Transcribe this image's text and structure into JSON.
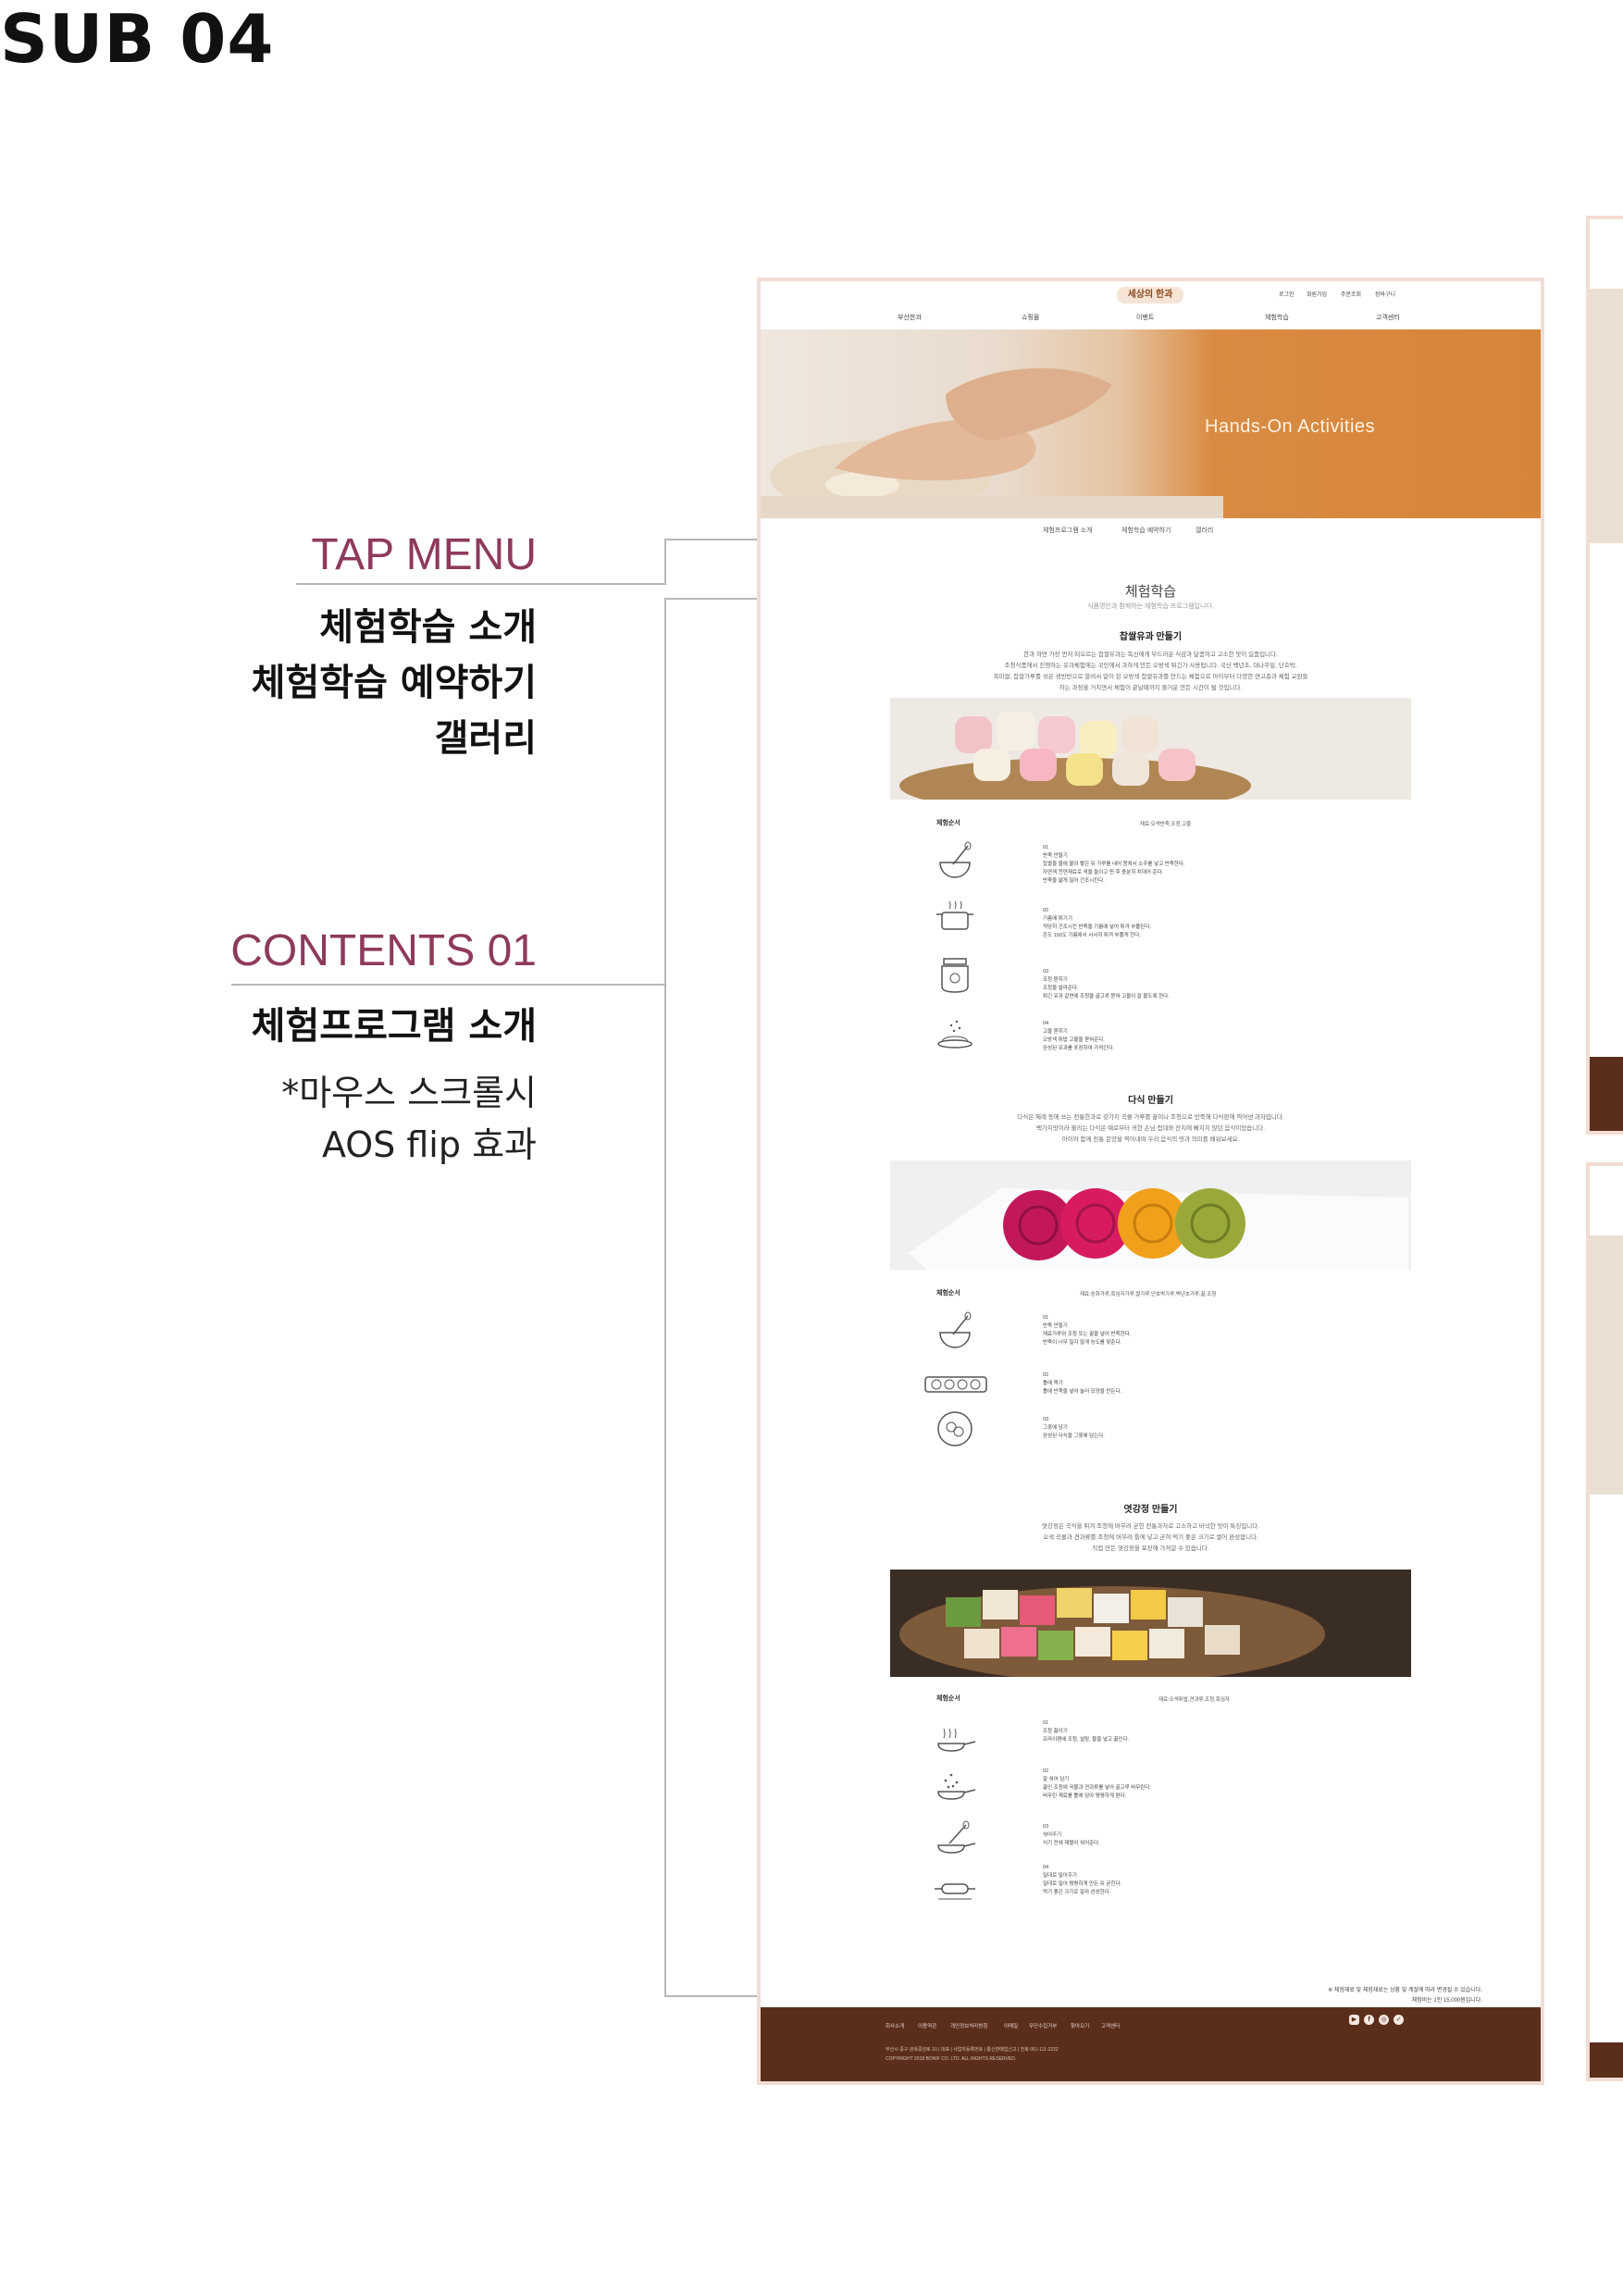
{
  "page": {
    "sub_title": "SUB 04",
    "tap_menu": {
      "heading": "TAP MENU",
      "items": [
        "체험학습 소개",
        "체험학습 예약하기",
        "갤러리"
      ]
    },
    "contents": {
      "heading": "CONTENTS 01",
      "title": "체험프로그램 소개",
      "notes": [
        "*마우스 스크롤시",
        "AOS flip 효과"
      ]
    }
  },
  "site": {
    "logo": "세상의 한과",
    "util_links": [
      "로그인",
      "회원가입",
      "주문조회",
      "장바구니"
    ],
    "gnb": [
      "부산한과",
      "쇼핑몰",
      "이벤트",
      "체험학습",
      "고객센터"
    ],
    "hero_title": "Hands-On Activities",
    "tabs": [
      "체험프로그램 소개",
      "체험학습 예약하기",
      "갤러리"
    ],
    "page_heading": "체험학습",
    "page_subheading": "식품명인과 함께하는 체험학습 프로그램입니다.",
    "sections": [
      {
        "title": "찹쌀유과 만들기",
        "paragraph": [
          "한과 하면 가장 먼저 떠오르는 찹쌀유과는 독신에게 부드러운 식감과 달콤하고 고소한 맛이 일품입니다.",
          "조청식품에서 진행하는 유과체험에는 국민에서 과하게 만든 오방색 튀긴가 사용됩니다. 국산 백년초, 대나무잎, 단호박,",
          "흑미쌀, 찹쌀가루를 섞은 생반반으로 말려서 알이 된 오방색 찹쌀유과를 만드는 체험으로 아이부터 다양한 연고층과 체험 교원들",
          "하는 과정을 거치면서 체험이 끝날때까지 즐거운 만든 시간이 될 것입니다."
        ],
        "order_label": "체험순서",
        "order_meta": "재료:오색반죽,조청,고물",
        "steps": [
          {
            "icon": "whisk-bowl-icon",
            "lines": [
              "01",
              "반죽 만들기",
              "찹쌀을 물에 불려 빻은 뒤 가루를 내어 뭉쳐서 소주를 넣고 반죽한다.",
              "자연색 천연재료로 색을 들이고 찐 후 충분히 치대어 준다.",
              "반죽을 얇게 밀어 건조시킨다."
            ]
          },
          {
            "icon": "pot-fry-icon",
            "lines": [
              "02",
              "기름에 튀기기",
              "적당히 건조시킨 반죽을 기름에 넣어 튀겨 부풀린다.",
              "온도 150도 기름에서 서서히 튀겨 부풀게 한다."
            ]
          },
          {
            "icon": "honey-jar-icon",
            "lines": [
              "03",
              "조청 묻히기",
              "조청을 발라준다.",
              "튀긴 유과 겉면에 조청을 골고루 묻혀 고물이 잘 붙도록 한다."
            ]
          },
          {
            "icon": "plate-icon",
            "lines": [
              "04",
              "고물 묻히기",
              "오방색 튀밥 고물을 묻혀준다.",
              "완성된 유과를 포장하여 가져간다."
            ]
          }
        ]
      },
      {
        "title": "다식 만들기",
        "paragraph": [
          "다식은 제례 등에 쓰는 전통한과로 갖가지 곡물 가루를 꿀이나 조청으로 반죽해 다식판에 찍어낸 과자입니다.",
          "백가지맛이라 불리는 다식은 예로부터 귀한 손님 접대와 잔치에 빠지지 않던 음식이었습니다.",
          "아이와 함께 전통 문양을 찍어내며 우리 음식의 멋과 의미를 배워보세요."
        ],
        "order_label": "체험순서",
        "order_meta": "재료:송화가루,흑임자가루,쌀가루,단호박가루,백년초가루,꿀,조청",
        "steps": [
          {
            "icon": "whisk-bowl-icon",
            "lines": [
              "01",
              "반죽 만들기",
              "재료가루와 조청 또는 꿀을 넣어 반죽한다.",
              "반죽이 너무 질지 않게 농도를 맞춘다."
            ]
          },
          {
            "icon": "mold-tray-icon",
            "lines": [
              "02",
              "틀에 찍기",
              "틀에 반죽을 넣어 눌러 모양을 만든다."
            ]
          },
          {
            "icon": "pattern-plate-icon",
            "lines": [
              "03",
              "그릇에 담기",
              "완성된 다식을 그릇에 담는다."
            ]
          }
        ]
      },
      {
        "title": "엿강정 만들기",
        "paragraph": [
          "엿강정은 곡식을 튀겨 조청에 버무려 굳힌 전통과자로 고소하고 바삭한 맛이 특징입니다.",
          "오색 곡물과 견과류를 조청에 버무려 틀에 넣고 굳혀 먹기 좋은 크기로 썰어 완성합니다.",
          "직접 만든 엿강정을 포장해 가져갈 수 있습니다."
        ],
        "order_label": "체험순서",
        "order_meta": "재료:오색튀밥,견과류,조청,흑임자",
        "steps": [
          {
            "icon": "steam-pan-icon",
            "lines": [
              "01",
              "조청 끓이기",
              "프라이팬에 조청, 설탕, 물을 넣고 끓인다."
            ]
          },
          {
            "icon": "mixing-pan-icon",
            "lines": [
              "02",
              "잘 섞어 담기",
              "끓인 조청에 곡물과 견과류를 넣어 골고루 버무린다.",
              "버무린 재료를 틀에 담아 평평하게 편다."
            ]
          },
          {
            "icon": "whisk-pan-icon",
            "lines": [
              "03",
              "섞어주기",
              "식기 전에 재빨리 섞어준다."
            ]
          },
          {
            "icon": "rolling-pin-icon",
            "lines": [
              "04",
              "밀대로 밀어주기",
              "밀대로 밀어 평평하게 만든 뒤 굳힌다.",
              "먹기 좋은 크기로 잘라 완성한다."
            ]
          }
        ]
      }
    ],
    "notice": [
      "※ 체험재료 및 체험재료는 상황 및 계절에 따라 변경될 수 있습니다.",
      "체험비는 1인 15,000원입니다."
    ],
    "footer": {
      "nav": [
        "회사소개",
        "이용약관",
        "개인정보처리방침",
        "이메일",
        "무단수집거부",
        "찾아오기",
        "고객센터"
      ],
      "address": "부산시 중구 광복중앙로 10 | 대표 | 사업자등록번호 | 통신판매업신고 | 전화 051-111-2222",
      "copyright": "COPYRIGHT 2018 BONIF CO. LTD. ALL RIGHTS RESERVED."
    }
  },
  "colors": {
    "accent_pink": "#8e3a5c",
    "hero_orange": "#d68538",
    "footer_brown": "#5b2e1c",
    "frame_border": "#f3dcd4"
  }
}
